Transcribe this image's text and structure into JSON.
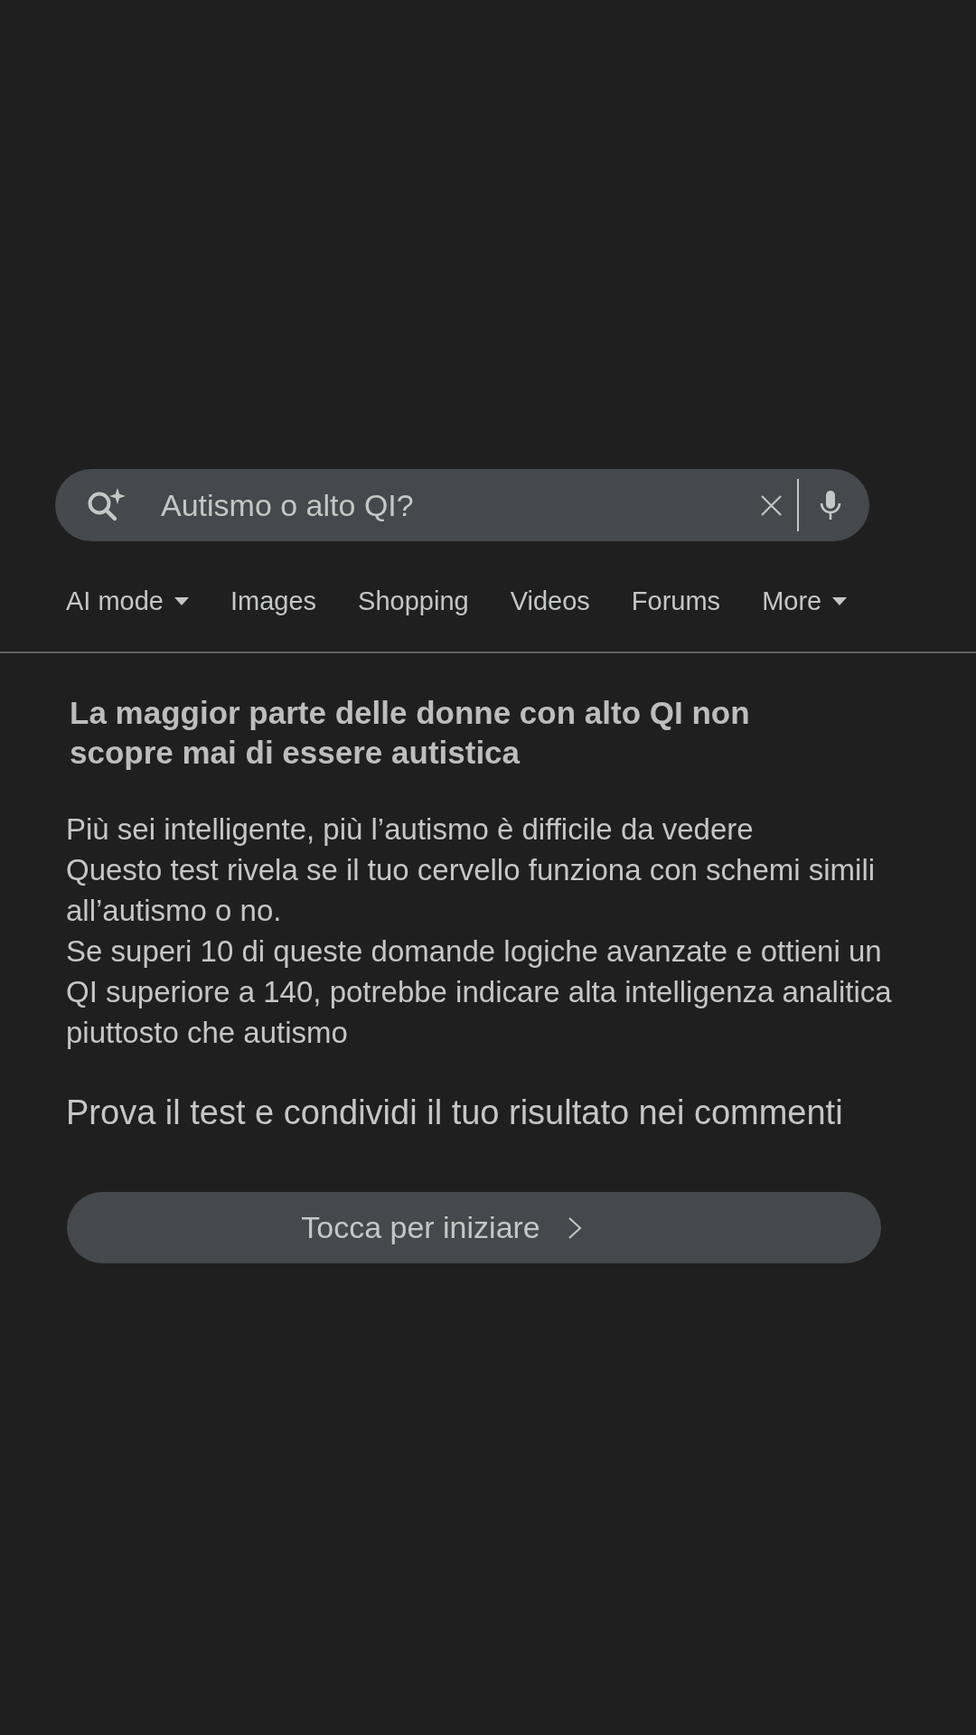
{
  "search": {
    "value": "Autismo o alto QI?"
  },
  "tabs": [
    {
      "label": "AI mode",
      "dropdown": true,
      "selected": false
    },
    {
      "label": "Images",
      "dropdown": false,
      "selected": false
    },
    {
      "label": "Shopping",
      "dropdown": false,
      "selected": false
    },
    {
      "label": "Videos",
      "dropdown": false,
      "selected": false
    },
    {
      "label": "Forums",
      "dropdown": false,
      "selected": false
    },
    {
      "label": "More",
      "dropdown": true,
      "selected": false
    }
  ],
  "article": {
    "title": "La maggior parte delle donne con alto QI non scopre mai di essere autistica",
    "body": [
      "Più sei intelligente, più l’autismo è difficile da vedere",
      "Questo test rivela se il tuo cervello funziona con schemi simili all’autismo o no.",
      "Se superi 10 di queste domande logiche avanzate e ottieni un QI superiore a 140, potrebbe indicare alta intelligenza analitica piuttosto che autismo"
    ],
    "prompt": "Prova il test e condividi il tuo risultato nei commenti"
  },
  "button": {
    "label": "Tocca per iniziare"
  }
}
